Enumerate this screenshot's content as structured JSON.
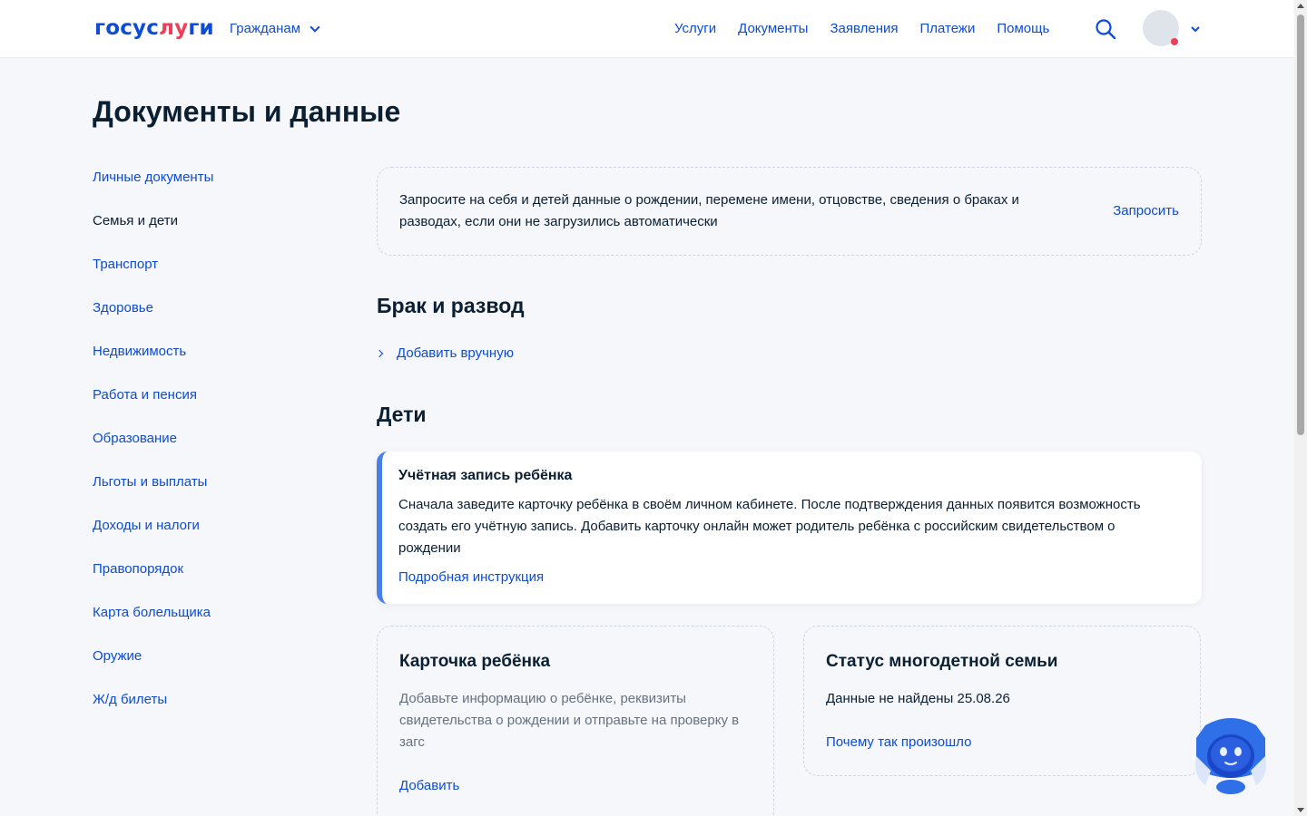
{
  "header": {
    "logo_part1": "госус",
    "logo_part2": "лу",
    "logo_part3": "ги",
    "audience_label": "Гражданам",
    "nav": [
      "Услуги",
      "Документы",
      "Заявления",
      "Платежи",
      "Помощь"
    ]
  },
  "page": {
    "title": "Документы и данные"
  },
  "sidebar": {
    "items": [
      {
        "label": "Личные документы"
      },
      {
        "label": "Семья и дети"
      },
      {
        "label": "Транспорт"
      },
      {
        "label": "Здоровье"
      },
      {
        "label": "Недвижимость"
      },
      {
        "label": "Работа и пенсия"
      },
      {
        "label": "Образование"
      },
      {
        "label": "Льготы и выплаты"
      },
      {
        "label": "Доходы и налоги"
      },
      {
        "label": "Правопорядок"
      },
      {
        "label": "Карта болельщика"
      },
      {
        "label": "Оружие"
      },
      {
        "label": "Ж/д билеты"
      }
    ],
    "active": "Семья и дети"
  },
  "request_panel": {
    "text": "Запросите на себя и детей данные о рождении, перемене имени, отцовстве, сведения о браках и разводах, если они не загрузились автоматически",
    "action": "Запросить"
  },
  "marriage": {
    "title": "Брак и развод",
    "add_manual": "Добавить вручную"
  },
  "children": {
    "title": "Дети",
    "notice": {
      "title": "Учётная запись ребёнка",
      "text": "Сначала заведите карточку ребёнка в своём личном кабинете. После подтверждения данных появится возможность создать его учётную запись. Добавить карточку онлайн может родитель ребёнка с российским свидетельством о рождении",
      "link": "Подробная инструкция"
    },
    "child_card": {
      "title": "Карточка ребёнка",
      "text": "Добавьте информацию о ребёнке, реквизиты свидетельства о рождении и отправьте на проверку в загс",
      "action": "Добавить"
    },
    "large_family": {
      "title": "Статус многодетной семьи",
      "text": "Данные не найдены 25.08.26",
      "link": "Почему так произошло"
    }
  },
  "colors": {
    "brand_blue": "#0d4cd3",
    "brand_red": "#ee3f58",
    "text": "#0b1f33",
    "background": "#f5f7fa",
    "accent_bar": "#4a7fe8"
  },
  "icons": [
    "search-icon",
    "chevron-down-icon",
    "chevron-right-icon",
    "assistant-robot-icon",
    "avatar"
  ]
}
